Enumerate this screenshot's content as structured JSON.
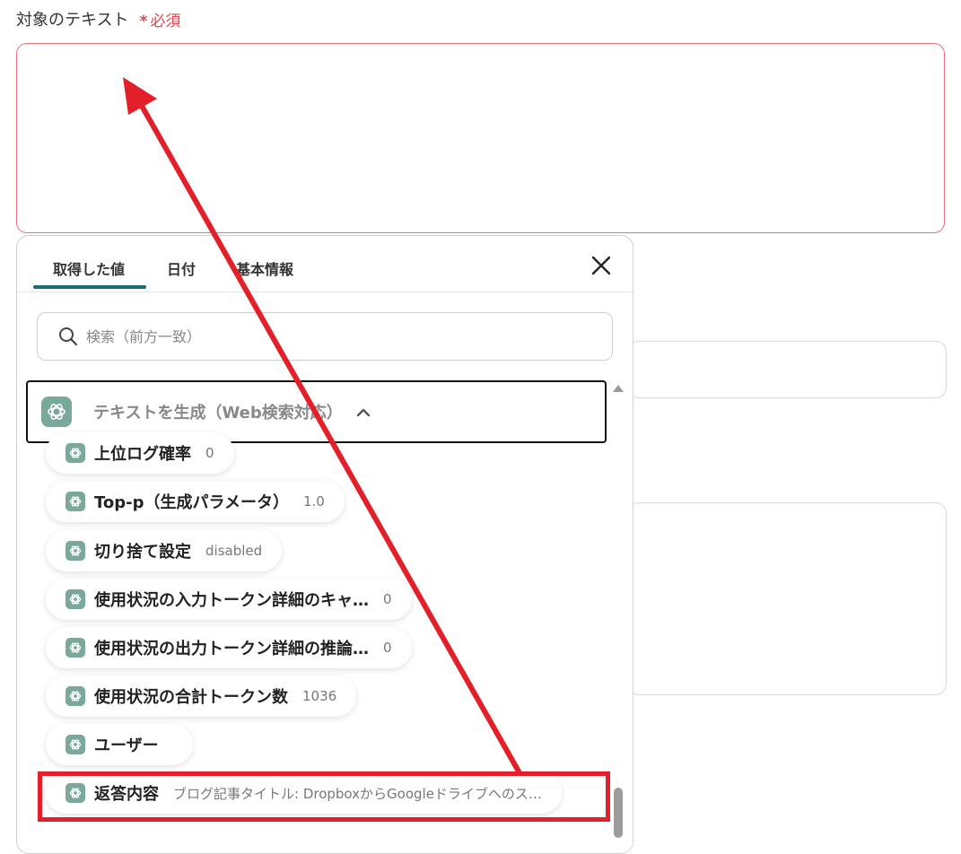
{
  "field": {
    "label": "対象のテキスト",
    "required_mark": "*",
    "required_text": "必須",
    "value": ""
  },
  "panel": {
    "tabs": [
      {
        "label": "取得した値",
        "active": true
      },
      {
        "label": "日付",
        "active": false
      },
      {
        "label": "基本情報",
        "active": false
      }
    ],
    "close_icon": "close-icon",
    "search": {
      "placeholder": "検索（前方一致）",
      "icon": "search-icon"
    },
    "group": {
      "title": "テキストを生成（Web検索対応）",
      "expanded": true
    },
    "items": [
      {
        "label": "上位ログ確率",
        "value": "0"
      },
      {
        "label": "Top-p（生成パラメータ）",
        "value": "1.0"
      },
      {
        "label": "切り捨て設定",
        "value": "disabled"
      },
      {
        "label": "使用状況の入力トークン詳細のキャ…",
        "value": "0"
      },
      {
        "label": "使用状況の出力トークン詳細の推論…",
        "value": "0"
      },
      {
        "label": "使用状況の合計トークン数",
        "value": "1036"
      },
      {
        "label": "ユーザー",
        "value": ""
      },
      {
        "label": "返答内容",
        "value": "ブログ記事タイトル: DropboxからGoogleドライブへのス…"
      }
    ]
  },
  "colors": {
    "accent": "#1b6b7a",
    "required": "#e0474f",
    "annotation": "#e3202a",
    "item_icon": "#7aa99b"
  }
}
